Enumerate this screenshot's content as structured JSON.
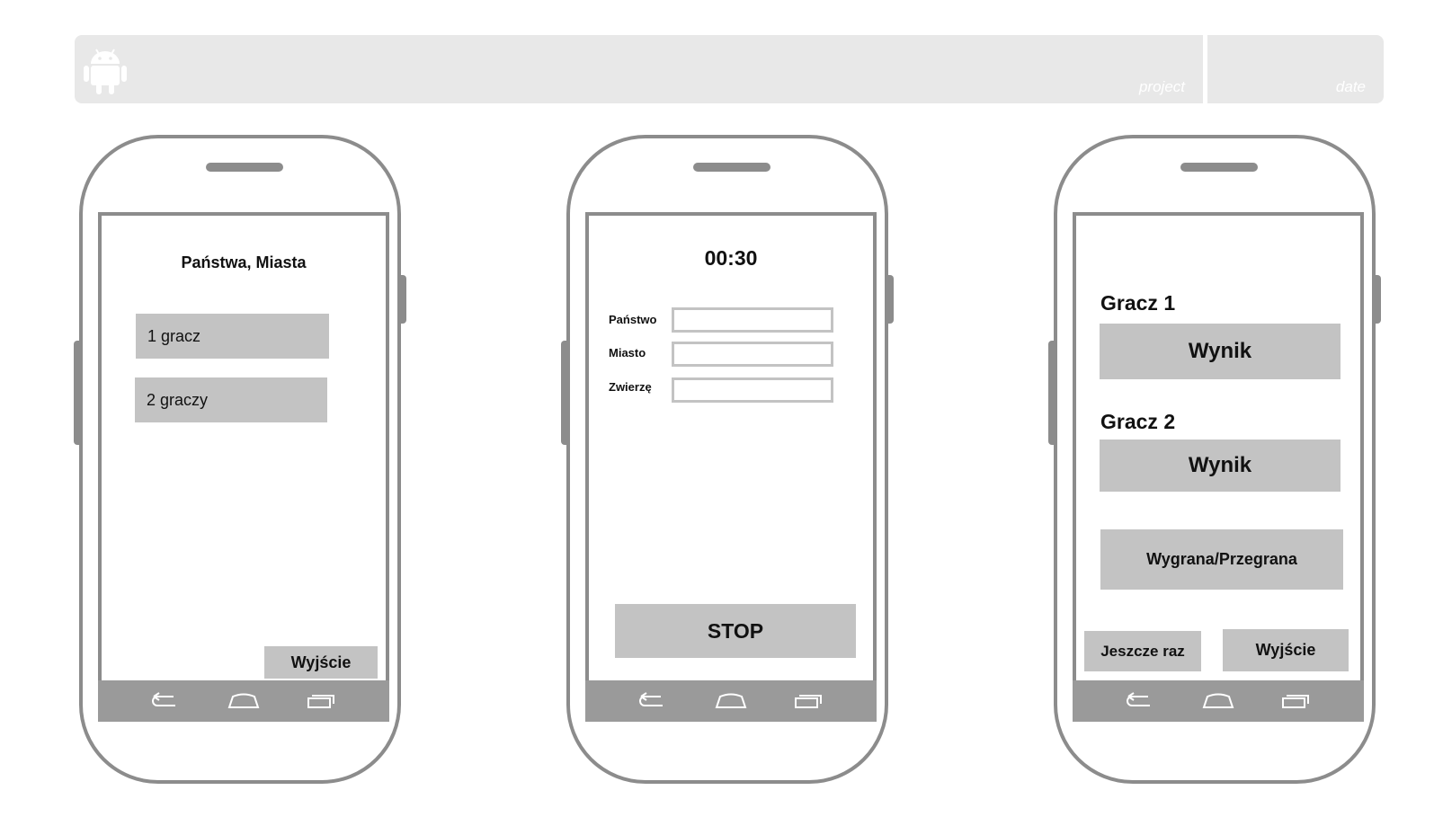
{
  "header": {
    "project_label": "project",
    "date_label": "date"
  },
  "screens": {
    "menu": {
      "title": "Państwa, Miasta",
      "one_player": "1 gracz",
      "two_players": "2 graczy",
      "exit": "Wyjście"
    },
    "game": {
      "timer": "00:30",
      "fields": [
        {
          "label": "Państwo",
          "value": ""
        },
        {
          "label": "Miasto",
          "value": ""
        },
        {
          "label": "Zwierzę",
          "value": ""
        }
      ],
      "stop": "STOP"
    },
    "result": {
      "player1": "Gracz 1",
      "score1": "Wynik",
      "player2": "Gracz 2",
      "score2": "Wynik",
      "outcome": "Wygrana/Przegrana",
      "again": "Jeszcze raz",
      "exit": "Wyjście"
    }
  },
  "icons": {
    "android": "android-icon",
    "back": "back-icon",
    "home": "home-icon",
    "recent": "recent-apps-icon"
  },
  "colors": {
    "frame": "#8c8c8c",
    "button": "#c3c3c3",
    "header": "#e8e8e8",
    "navbar": "#9a9a9a"
  }
}
